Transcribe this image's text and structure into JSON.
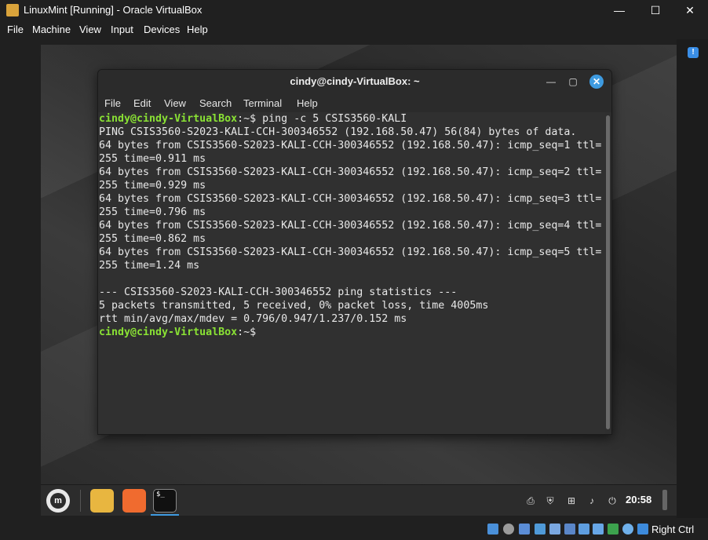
{
  "window": {
    "title": "LinuxMint [Running] - Oracle VirtualBox",
    "controls": {
      "minimize": "—",
      "maximize": "☐",
      "close": "✕"
    }
  },
  "vbox_menu": [
    "File",
    "Machine",
    "View",
    "Input",
    "Devices",
    "Help"
  ],
  "terminal": {
    "title": "cindy@cindy-VirtualBox: ~",
    "menu": [
      "File",
      "Edit",
      "View",
      "Search",
      "Terminal",
      "Help"
    ],
    "prompt_user": "cindy@cindy-VirtualBox",
    "prompt_suffix": ":~$",
    "command": " ping -c 5 CSIS3560-KALI",
    "output": "PING CSIS3560-S2023-KALI-CCH-300346552 (192.168.50.47) 56(84) bytes of data.\n64 bytes from CSIS3560-S2023-KALI-CCH-300346552 (192.168.50.47): icmp_seq=1 ttl=\n255 time=0.911 ms\n64 bytes from CSIS3560-S2023-KALI-CCH-300346552 (192.168.50.47): icmp_seq=2 ttl=\n255 time=0.929 ms\n64 bytes from CSIS3560-S2023-KALI-CCH-300346552 (192.168.50.47): icmp_seq=3 ttl=\n255 time=0.796 ms\n64 bytes from CSIS3560-S2023-KALI-CCH-300346552 (192.168.50.47): icmp_seq=4 ttl=\n255 time=0.862 ms\n64 bytes from CSIS3560-S2023-KALI-CCH-300346552 (192.168.50.47): icmp_seq=5 ttl=\n255 time=1.24 ms\n\n--- CSIS3560-S2023-KALI-CCH-300346552 ping statistics ---\n5 packets transmitted, 5 received, 0% packet loss, time 4005ms\nrtt min/avg/max/mdev = 0.796/0.947/1.237/0.152 ms",
    "prompt2_user": "cindy@cindy-VirtualBox",
    "prompt2_suffix": ":~$"
  },
  "panel": {
    "menu_glyph": "m",
    "terminal_launcher_glyph": "$_",
    "clock": "20:58"
  },
  "statusbar": {
    "host_key": "Right Ctrl"
  }
}
